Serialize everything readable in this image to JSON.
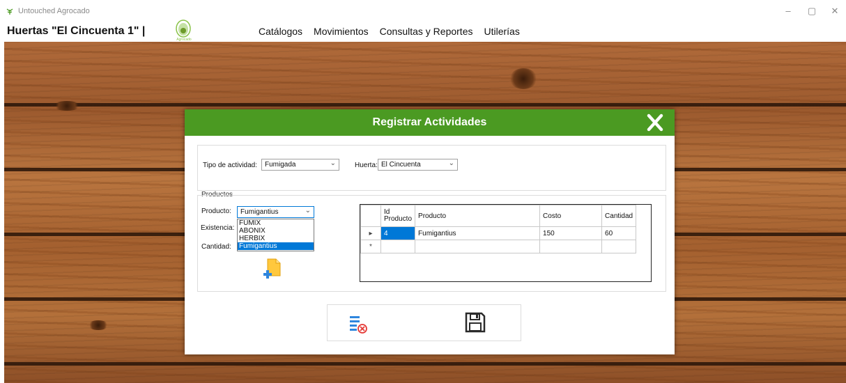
{
  "window": {
    "title": "Untouched Agrocado",
    "controls": [
      "–",
      "▢",
      "✕"
    ]
  },
  "header": {
    "brand": "Huertas \"El Cincuenta 1\" |",
    "logo_text": "Agrocado"
  },
  "menu": [
    "Catálogos",
    "Movimientos",
    "Consultas y Reportes",
    "Utilerías"
  ],
  "dialog": {
    "title": "Registrar Actividades",
    "tipo_label": "Tipo de actividad:",
    "tipo_value": "Fumigada",
    "huerta_label": "Huerta:",
    "huerta_value": "El Cincuenta",
    "productos_group": "Productos",
    "producto_label": "Producto:",
    "producto_value": "Fumigantius",
    "existencia_label": "Existencia:",
    "cantidad_label": "Cantidad:",
    "dropdown_options": [
      "FUMIX",
      "ABONIX",
      "HERBIX",
      "Fumigantius"
    ],
    "grid": {
      "columns": [
        "Id Producto",
        "Producto",
        "Costo",
        "Cantidad"
      ],
      "rows": [
        {
          "id": "4",
          "producto": "Fumigantius",
          "costo": "150",
          "cantidad": "60"
        }
      ],
      "current_row_marker": "▸",
      "new_row_marker": "*"
    }
  },
  "colors": {
    "header_green": "#4b9a22",
    "selection_blue": "#0078d7"
  },
  "icons": {
    "add_product": "add-file-icon",
    "cancel": "clear-list-icon",
    "save": "save-icon",
    "close": "close-icon"
  }
}
